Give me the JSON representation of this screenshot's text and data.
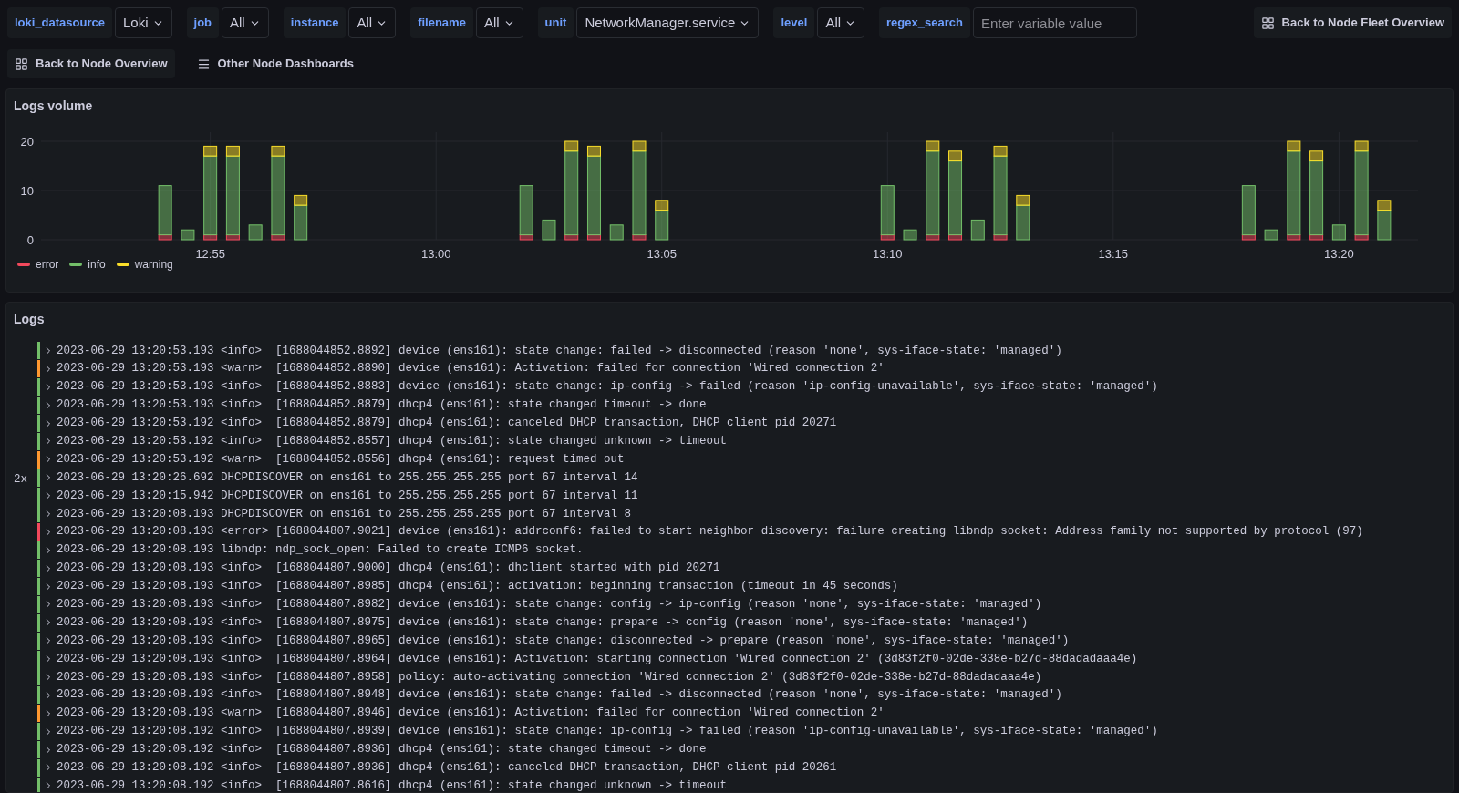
{
  "variables": [
    {
      "label": "loki_datasource",
      "kind": "select",
      "value": "Loki"
    },
    {
      "label": "job",
      "kind": "select",
      "value": "All"
    },
    {
      "label": "instance",
      "kind": "select",
      "value": "All"
    },
    {
      "label": "filename",
      "kind": "select",
      "value": "All"
    },
    {
      "label": "unit",
      "kind": "select",
      "value": "NetworkManager.service"
    },
    {
      "label": "level",
      "kind": "select",
      "value": "All"
    },
    {
      "label": "regex_search",
      "kind": "text",
      "placeholder": "Enter variable value"
    }
  ],
  "fleet_link": "Back to Node Fleet Overview",
  "links": [
    {
      "label": "Back to Node Overview",
      "kind": "button"
    },
    {
      "label": "Other Node Dashboards",
      "kind": "menu"
    }
  ],
  "volume_panel": {
    "title": "Logs volume",
    "chart_data": {
      "type": "bar",
      "stacked": true,
      "categories": [
        null,
        null,
        null,
        null,
        null,
        null,
        null,
        "12:55",
        null,
        null,
        null,
        null,
        null,
        null,
        null,
        null,
        null,
        "13:00",
        null,
        null,
        null,
        null,
        null,
        null,
        null,
        null,
        null,
        "13:05",
        null,
        null,
        null,
        null,
        null,
        null,
        null,
        null,
        null,
        "13:10",
        null,
        null,
        null,
        null,
        null,
        null,
        null,
        null,
        null,
        "13:15",
        null,
        null,
        null,
        null,
        null,
        null,
        null,
        null,
        null,
        "13:20",
        null,
        null,
        null
      ],
      "ylim": [
        0,
        20
      ],
      "yticks": [
        0,
        10,
        20
      ],
      "grid": true,
      "series": [
        {
          "name": "error",
          "color": "#f2495c",
          "values": [
            null,
            null,
            null,
            null,
            null,
            1,
            0,
            1,
            1,
            0,
            1,
            0,
            null,
            null,
            null,
            null,
            null,
            null,
            null,
            null,
            null,
            1,
            0,
            1,
            1,
            0,
            1,
            0,
            null,
            null,
            null,
            null,
            null,
            null,
            null,
            null,
            null,
            1,
            0,
            1,
            1,
            0,
            1,
            0,
            null,
            null,
            null,
            null,
            null,
            null,
            null,
            null,
            null,
            1,
            0,
            1,
            1,
            0,
            1,
            0,
            null
          ]
        },
        {
          "name": "info",
          "color": "#73bf69",
          "values": [
            null,
            null,
            null,
            null,
            null,
            10,
            2,
            16,
            16,
            3,
            16,
            7,
            null,
            null,
            null,
            null,
            null,
            null,
            null,
            null,
            null,
            10,
            4,
            17,
            16,
            3,
            17,
            6,
            null,
            null,
            null,
            null,
            null,
            null,
            null,
            null,
            null,
            10,
            2,
            17,
            15,
            4,
            16,
            7,
            null,
            null,
            null,
            null,
            null,
            null,
            null,
            null,
            null,
            10,
            2,
            17,
            15,
            3,
            17,
            6,
            null
          ]
        },
        {
          "name": "warning",
          "color": "#fade2a",
          "values": [
            null,
            null,
            null,
            null,
            null,
            0,
            0,
            2,
            2,
            0,
            2,
            2,
            null,
            null,
            null,
            null,
            null,
            null,
            null,
            null,
            null,
            0,
            0,
            2,
            2,
            0,
            2,
            2,
            null,
            null,
            null,
            null,
            null,
            null,
            null,
            null,
            null,
            0,
            0,
            2,
            2,
            0,
            2,
            2,
            null,
            null,
            null,
            null,
            null,
            null,
            null,
            null,
            null,
            0,
            0,
            2,
            2,
            0,
            2,
            2,
            null
          ]
        }
      ]
    }
  },
  "logs_panel": {
    "title": "Logs",
    "rows": [
      {
        "color": "#73bf69",
        "text": "2023-06-29 13:20:53.193 <info>  [1688044852.8892] device (ens161): state change: failed -> disconnected (reason 'none', sys-iface-state: 'managed')"
      },
      {
        "color": "#ff9830",
        "text": "2023-06-29 13:20:53.193 <warn>  [1688044852.8890] device (ens161): Activation: failed for connection 'Wired connection 2'"
      },
      {
        "color": "#73bf69",
        "text": "2023-06-29 13:20:53.193 <info>  [1688044852.8883] device (ens161): state change: ip-config -> failed (reason 'ip-config-unavailable', sys-iface-state: 'managed')"
      },
      {
        "color": "#73bf69",
        "text": "2023-06-29 13:20:53.193 <info>  [1688044852.8879] dhcp4 (ens161): state changed timeout -> done"
      },
      {
        "color": "#73bf69",
        "text": "2023-06-29 13:20:53.192 <info>  [1688044852.8879] dhcp4 (ens161): canceled DHCP transaction, DHCP client pid 20271"
      },
      {
        "color": "#73bf69",
        "text": "2023-06-29 13:20:53.192 <info>  [1688044852.8557] dhcp4 (ens161): state changed unknown -> timeout"
      },
      {
        "color": "#ff9830",
        "text": "2023-06-29 13:20:53.192 <warn>  [1688044852.8556] dhcp4 (ens161): request timed out"
      },
      {
        "color": "#73bf69",
        "count": "2x",
        "text": "2023-06-29 13:20:26.692 DHCPDISCOVER on ens161 to 255.255.255.255 port 67 interval 14"
      },
      {
        "color": "#73bf69",
        "text": "2023-06-29 13:20:15.942 DHCPDISCOVER on ens161 to 255.255.255.255 port 67 interval 11"
      },
      {
        "color": "#73bf69",
        "text": "2023-06-29 13:20:08.193 DHCPDISCOVER on ens161 to 255.255.255.255 port 67 interval 8"
      },
      {
        "color": "#f2495c",
        "text": "2023-06-29 13:20:08.193 <error> [1688044807.9021] device (ens161): addrconf6: failed to start neighbor discovery: failure creating libndp socket: Address family not supported by protocol (97)"
      },
      {
        "color": "#73bf69",
        "text": "2023-06-29 13:20:08.193 libndp: ndp_sock_open: Failed to create ICMP6 socket."
      },
      {
        "color": "#73bf69",
        "text": "2023-06-29 13:20:08.193 <info>  [1688044807.9000] dhcp4 (ens161): dhclient started with pid 20271"
      },
      {
        "color": "#73bf69",
        "text": "2023-06-29 13:20:08.193 <info>  [1688044807.8985] dhcp4 (ens161): activation: beginning transaction (timeout in 45 seconds)"
      },
      {
        "color": "#73bf69",
        "text": "2023-06-29 13:20:08.193 <info>  [1688044807.8982] device (ens161): state change: config -> ip-config (reason 'none', sys-iface-state: 'managed')"
      },
      {
        "color": "#73bf69",
        "text": "2023-06-29 13:20:08.193 <info>  [1688044807.8975] device (ens161): state change: prepare -> config (reason 'none', sys-iface-state: 'managed')"
      },
      {
        "color": "#73bf69",
        "text": "2023-06-29 13:20:08.193 <info>  [1688044807.8965] device (ens161): state change: disconnected -> prepare (reason 'none', sys-iface-state: 'managed')"
      },
      {
        "color": "#73bf69",
        "text": "2023-06-29 13:20:08.193 <info>  [1688044807.8964] device (ens161): Activation: starting connection 'Wired connection 2' (3d83f2f0-02de-338e-b27d-88dadadaaa4e)"
      },
      {
        "color": "#73bf69",
        "text": "2023-06-29 13:20:08.193 <info>  [1688044807.8958] policy: auto-activating connection 'Wired connection 2' (3d83f2f0-02de-338e-b27d-88dadadaaa4e)"
      },
      {
        "color": "#73bf69",
        "text": "2023-06-29 13:20:08.193 <info>  [1688044807.8948] device (ens161): state change: failed -> disconnected (reason 'none', sys-iface-state: 'managed')"
      },
      {
        "color": "#ff9830",
        "text": "2023-06-29 13:20:08.193 <warn>  [1688044807.8946] device (ens161): Activation: failed for connection 'Wired connection 2'"
      },
      {
        "color": "#73bf69",
        "text": "2023-06-29 13:20:08.192 <info>  [1688044807.8939] device (ens161): state change: ip-config -> failed (reason 'ip-config-unavailable', sys-iface-state: 'managed')"
      },
      {
        "color": "#73bf69",
        "text": "2023-06-29 13:20:08.192 <info>  [1688044807.8936] dhcp4 (ens161): state changed timeout -> done"
      },
      {
        "color": "#73bf69",
        "text": "2023-06-29 13:20:08.192 <info>  [1688044807.8936] dhcp4 (ens161): canceled DHCP transaction, DHCP client pid 20261"
      },
      {
        "color": "#73bf69",
        "text": "2023-06-29 13:20:08.192 <info>  [1688044807.8616] dhcp4 (ens161): state changed unknown -> timeout"
      }
    ]
  }
}
